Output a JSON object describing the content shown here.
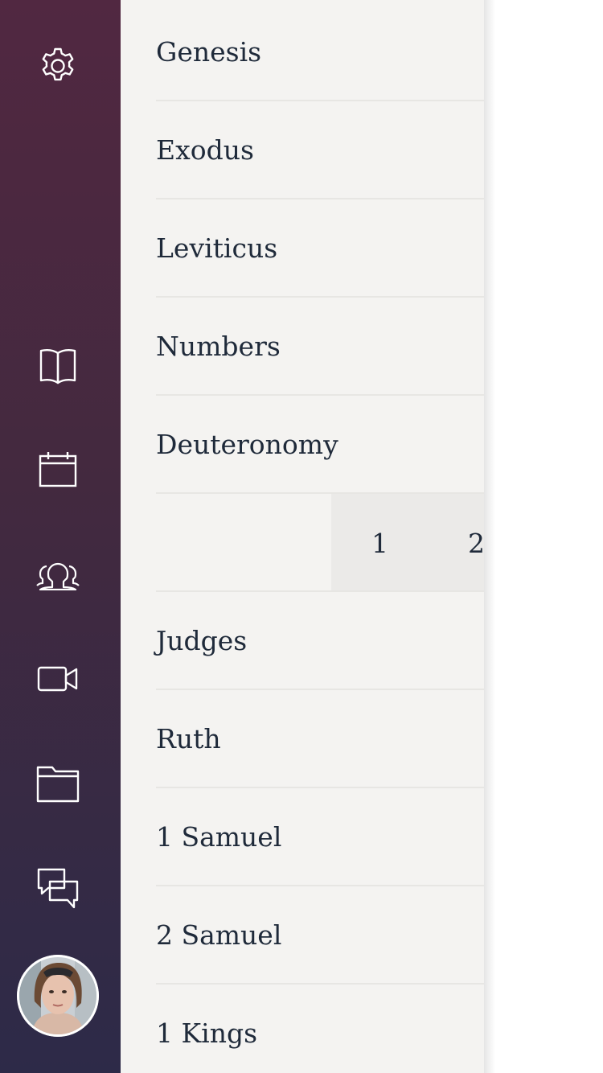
{
  "rail": {
    "icons": [
      "gear-icon",
      "book-icon",
      "calendar-icon",
      "group-icon",
      "video-icon",
      "folder-icon",
      "chat-icon"
    ],
    "avatar_alt": "user-avatar"
  },
  "books": {
    "items": [
      {
        "label": "Genesis"
      },
      {
        "label": "Exodus"
      },
      {
        "label": "Leviticus"
      },
      {
        "label": "Numbers"
      },
      {
        "label": "Deuteronomy"
      },
      {
        "label": "Judges"
      },
      {
        "label": "Ruth"
      },
      {
        "label": "1 Samuel"
      },
      {
        "label": "2 Samuel"
      },
      {
        "label": "1 Kings"
      }
    ],
    "chapters": [
      "1",
      "2"
    ]
  },
  "colors": {
    "rail_top": "#512841",
    "rail_bottom": "#2d2a48",
    "panel_bg": "#f4f3f1",
    "text": "#1f2a3a",
    "chapter_strip": "#ebeae8"
  }
}
